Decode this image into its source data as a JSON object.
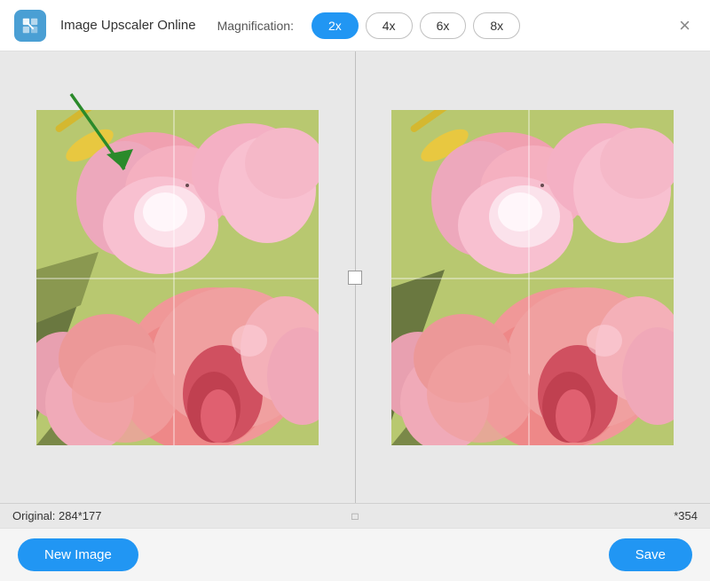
{
  "app": {
    "title": "Image Upscaler Online",
    "icon_label": "upscaler-app-icon"
  },
  "header": {
    "magnification_label": "Magnification:",
    "close_label": "×",
    "mag_buttons": [
      {
        "label": "2x",
        "value": "2x",
        "active": true
      },
      {
        "label": "4x",
        "value": "4x",
        "active": false
      },
      {
        "label": "6x",
        "value": "6x",
        "active": false
      },
      {
        "label": "8x",
        "value": "8x",
        "active": false
      }
    ]
  },
  "main": {
    "original_size_label": "Original: 284*177",
    "upscaled_size_label": "*354",
    "divider_handle": "□"
  },
  "footer": {
    "new_image_label": "New Image",
    "save_label": "Save"
  }
}
